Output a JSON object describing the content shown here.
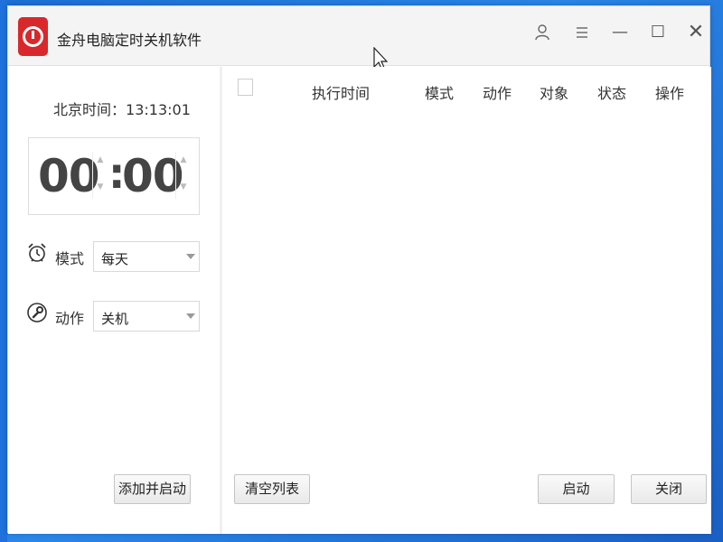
{
  "window": {
    "title": "金舟电脑定时关机软件"
  },
  "titlebar": {
    "user_icon": "user-icon",
    "menu_icon": "menu-icon",
    "minimize_glyph": "—",
    "maximize_glyph": "☐",
    "close_glyph": "✕"
  },
  "clock": {
    "label": "北京时间：",
    "value": "13:13:01"
  },
  "timer": {
    "hours": "00",
    "colon": ":",
    "minutes": "00"
  },
  "mode": {
    "label": "模式",
    "value": "每天"
  },
  "action": {
    "label": "动作",
    "value": "关机"
  },
  "buttons": {
    "add_start": "添加并启动",
    "clear_list": "清空列表",
    "start": "启动",
    "close": "关闭"
  },
  "table": {
    "columns": [
      "执行时间",
      "模式",
      "动作",
      "对象",
      "状态",
      "操作"
    ],
    "rows": []
  },
  "colors": {
    "accent": "#d8282b",
    "desktop": "#1d6fd6"
  }
}
